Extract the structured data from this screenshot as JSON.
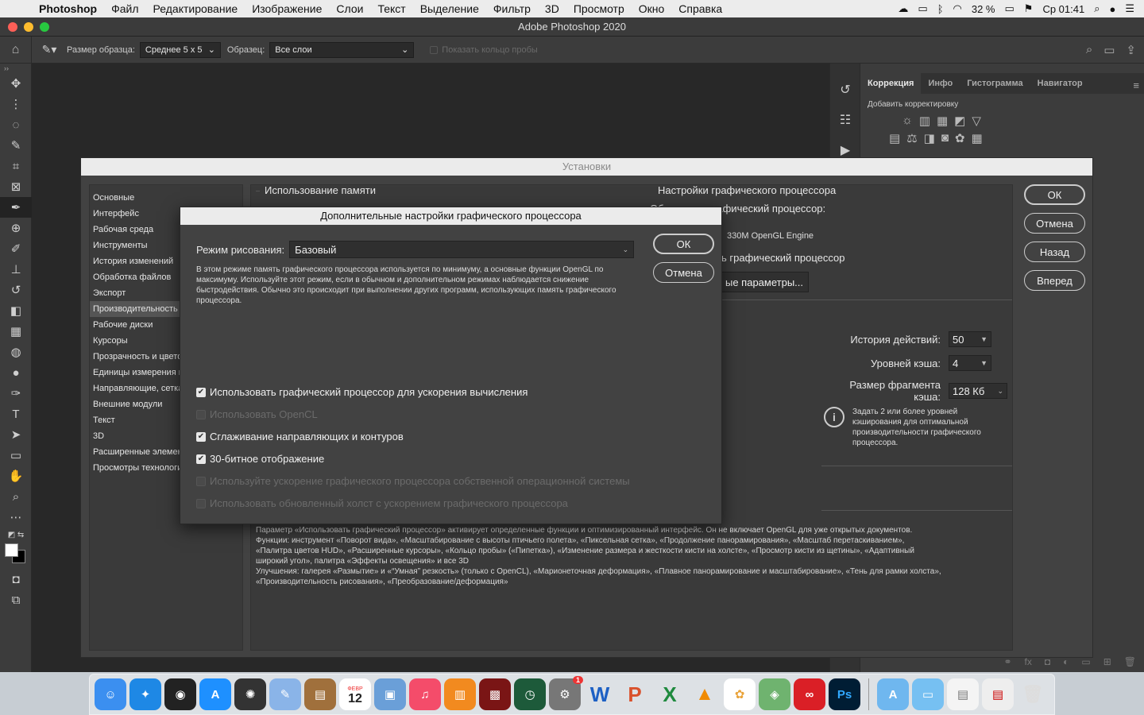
{
  "menubar": {
    "app_name": "Photoshop",
    "items": [
      "Файл",
      "Редактирование",
      "Изображение",
      "Слои",
      "Текст",
      "Выделение",
      "Фильтр",
      "3D",
      "Просмотр",
      "Окно",
      "Справка"
    ],
    "battery": "32 %",
    "clock": "Ср 01:41"
  },
  "window": {
    "title": "Adobe Photoshop 2020"
  },
  "options_bar": {
    "sample_size_label": "Размер образца:",
    "sample_size_value": "Среднее 5 x 5",
    "sample_label": "Образец:",
    "sample_value": "Все слои",
    "show_ring_label": "Показать кольцо пробы"
  },
  "right_panel": {
    "tabs": [
      "Коррекция",
      "Инфо",
      "Гистограмма",
      "Навигатор"
    ],
    "subtitle": "Добавить корректировку"
  },
  "prefs": {
    "title": "Установки",
    "sidebar": [
      "Основные",
      "Интерфейс",
      "Рабочая среда",
      "Инструменты",
      "История изменений",
      "Обработка файлов",
      "Экспорт",
      "Производительность",
      "Рабочие диски",
      "Курсоры",
      "Прозрачность и цвето",
      "Единицы измерения и",
      "Направляющие, сетка",
      "Внешние модули",
      "Текст",
      "3D",
      "Расширенные элемен",
      "Просмотры технологи"
    ],
    "memory_group": "Использование памяти",
    "gpu_group": "Настройки графического процессора",
    "gpu_detected_label": "Обнаружен графический процессор:",
    "gpu_engine": "330M OpenGL Engine",
    "use_gpu_label": "ь графический процессор",
    "adv_button": "ые параметры...",
    "history_label": "История действий:",
    "history_value": "50",
    "cache_levels_label": "Уровней кэша:",
    "cache_levels_value": "4",
    "cache_tile_label": "Размер фрагмента кэша:",
    "cache_tile_value": "128 Кб",
    "info_text": "Задать 2 или более уровней кэширования для оптимальной производительности графического процессора.",
    "description": [
      "Параметр «Использовать графический процессор» активирует определенные функции и оптимизированный интерфейс. Он не включает OpenGL для уже открытых документов.",
      "Функции: инструмент «Поворот вида», «Масштабирование с высоты птичьего полета», «Пиксельная сетка», «Продолжение панорамирования», «Масштаб перетаскиванием»,",
      "«Палитра цветов HUD», «Расширенные курсоры», «Кольцо пробы» («Пипетка»), «Изменение размера и жесткости кисти на холсте», «Просмотр кисти из щетины», «Адаптивный",
      "широкий угол», палитра «Эффекты освещения» и все 3D",
      "Улучшения: галерея «Размытие» и «“Умная” резкость» (только с OpenCL), «Марионеточная деформация», «Плавное панорамирование и масштабирование», «Тень для рамки холста»,",
      "«Производительность рисования», «Преобразование/деформация»"
    ],
    "buttons": {
      "ok": "ОК",
      "cancel": "Отмена",
      "back": "Назад",
      "forward": "Вперед"
    }
  },
  "adv": {
    "title": "Дополнительные настройки графического процессора",
    "mode_label": "Режим рисования:",
    "mode_value": "Базовый",
    "mode_desc": "В этом режиме память графического процессора используется по минимуму, а основные функции OpenGL по максимуму.  Используйте этот режим, если в обычном и дополнительном режимах наблюдается снижение быстродействия.  Обычно это происходит при выполнении других программ, использующих память графического процессора.",
    "ok": "ОК",
    "cancel": "Отмена",
    "checkboxes": [
      {
        "label": "Использовать графический процессор для ускорения вычисления",
        "checked": true,
        "enabled": true
      },
      {
        "label": "Использовать OpenCL",
        "checked": false,
        "enabled": false
      },
      {
        "label": "Сглаживание направляющих и контуров",
        "checked": true,
        "enabled": true
      },
      {
        "label": "30-битное отображение",
        "checked": true,
        "enabled": true
      },
      {
        "label": "Используйте ускорение графического процессора собственной операционной системы",
        "checked": false,
        "enabled": false
      },
      {
        "label": "Использовать обновленный холст с ускорением графического процессора",
        "checked": false,
        "enabled": false
      }
    ]
  },
  "dock": {
    "calendar_day": "12",
    "calendar_month": "ФЕВР",
    "badge": "1"
  }
}
